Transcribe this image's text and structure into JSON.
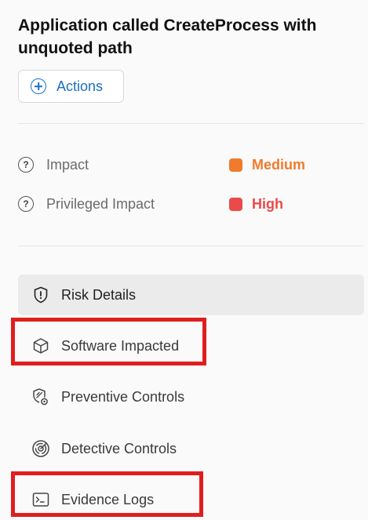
{
  "header": {
    "title": "Application called CreateProcess with unquoted path",
    "actions_label": "Actions"
  },
  "impacts": [
    {
      "label": "Impact",
      "value": "Medium",
      "color": "#f07a2d"
    },
    {
      "label": "Privileged Impact",
      "value": "High",
      "color": "#ea4a4a"
    }
  ],
  "nav": {
    "items": [
      {
        "label": "Risk Details",
        "icon": "shield-alert-icon",
        "active": true
      },
      {
        "label": "Software Impacted",
        "icon": "cube-icon",
        "active": false
      },
      {
        "label": "Preventive Controls",
        "icon": "shield-settings-icon",
        "active": false
      },
      {
        "label": "Detective Controls",
        "icon": "radar-icon",
        "active": false
      },
      {
        "label": "Evidence Logs",
        "icon": "terminal-icon",
        "active": false
      }
    ]
  },
  "annotations": {
    "highlight_color": "#e01e1e",
    "highlighted_items": [
      "Software Impacted",
      "Evidence Logs"
    ]
  }
}
